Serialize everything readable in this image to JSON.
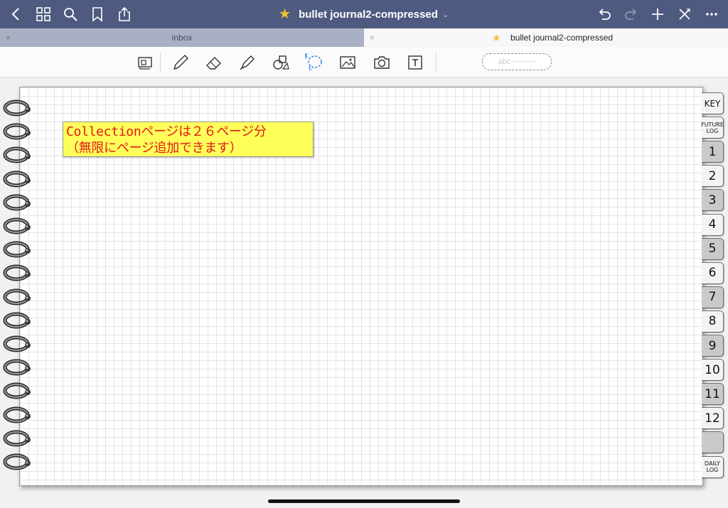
{
  "app": {
    "doc_title": "bullet journal2-compressed",
    "title_chevron": "⌄"
  },
  "topbar": {
    "left_icons": [
      "back-icon",
      "grid-icon",
      "search-icon",
      "bookmark-icon",
      "share-icon"
    ],
    "right_icons": [
      "undo-icon",
      "redo-icon",
      "add-page-icon",
      "close-edit-icon",
      "more-icon"
    ]
  },
  "tabs": [
    {
      "label": "inbox",
      "close": "×",
      "active": false
    },
    {
      "label": "bullet journal2-compressed",
      "close": "×",
      "active": true,
      "starred": true
    }
  ],
  "toolbar": {
    "tools": [
      "zoom-window",
      "pen",
      "eraser",
      "highlighter",
      "shapes",
      "lasso",
      "image",
      "camera",
      "text"
    ],
    "selected_tool": "lasso",
    "textbox_placeholder": "abc ~~~~~"
  },
  "page": {
    "sticky_note": "Collectionページは２６ページ分\n（無限にページ追加できます）",
    "ring_count": 16
  },
  "index_tabs": [
    {
      "label": "KEY",
      "style": "light"
    },
    {
      "label": "FUTURE LOG",
      "style": "light"
    },
    {
      "label": "1",
      "style": "dark"
    },
    {
      "label": "2",
      "style": "light"
    },
    {
      "label": "3",
      "style": "dark"
    },
    {
      "label": "4",
      "style": "light"
    },
    {
      "label": "5",
      "style": "dark"
    },
    {
      "label": "6",
      "style": "light"
    },
    {
      "label": "7",
      "style": "dark"
    },
    {
      "label": "8",
      "style": "light"
    },
    {
      "label": "9",
      "style": "dark"
    },
    {
      "label": "10",
      "style": "light"
    },
    {
      "label": "11",
      "style": "dark"
    },
    {
      "label": "12",
      "style": "light"
    },
    {
      "label": "",
      "style": "dark"
    },
    {
      "label": "DAILY LOG",
      "style": "light"
    }
  ],
  "colors": {
    "topbar": "#4e5a7f",
    "sticky_bg": "#ffff5a",
    "sticky_text": "#e01818",
    "lasso_accent": "#3a8de0"
  }
}
